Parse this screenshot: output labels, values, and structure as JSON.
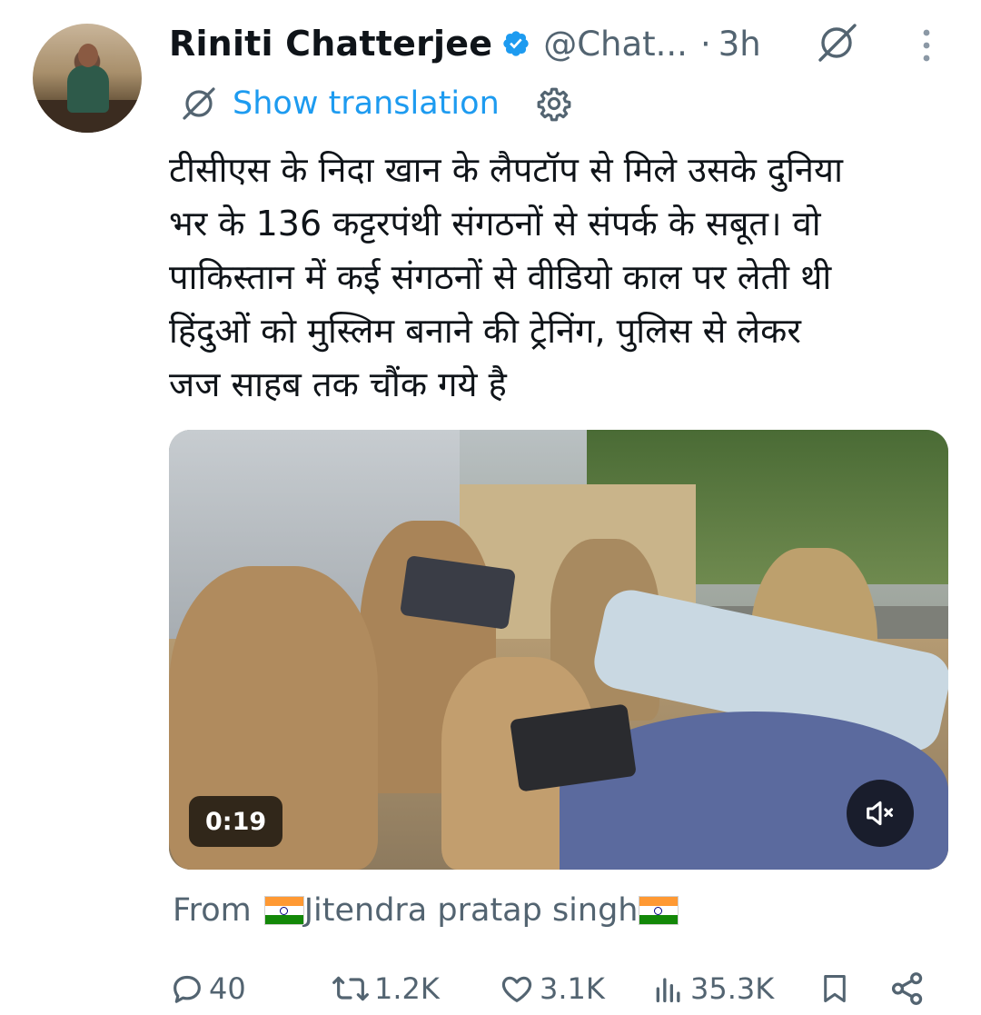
{
  "tweet": {
    "author_name": "Riniti Chatterjee",
    "handle": "@Chat...",
    "separator": "·",
    "time": "3h",
    "show_translation": "Show translation",
    "text_lines": [
      "टीसीएस के निदा खान के लैपटॉप से मिले उसके दुनिया",
      "भर के 136 कट्टरपंथी संगठनों से संपर्क के सबूत। वो",
      "पाकिस्तान में कई संगठनों से वीडियो काल पर लेती थी",
      "हिंदुओं को मुस्लिम बनाने की ट्रेनिंग, पुलिस से लेकर",
      "जज साहब तक चौंक गये है"
    ],
    "video": {
      "duration": "0:19"
    },
    "from_prefix": "From",
    "from_name": "Jitendra pratap singh",
    "actions": {
      "replies": "40",
      "reposts": "1.2K",
      "likes": "3.1K",
      "views": "35.3K"
    }
  },
  "colors": {
    "link": "#1d9bf0",
    "secondary_text": "#536471",
    "verified": "#1d9bf0"
  },
  "icons": [
    "verified-badge-icon",
    "globe-slash-icon",
    "more-vertical-icon",
    "gear-icon",
    "mute-icon",
    "reply-icon",
    "repost-icon",
    "like-icon",
    "views-icon",
    "bookmark-icon",
    "share-icon"
  ]
}
